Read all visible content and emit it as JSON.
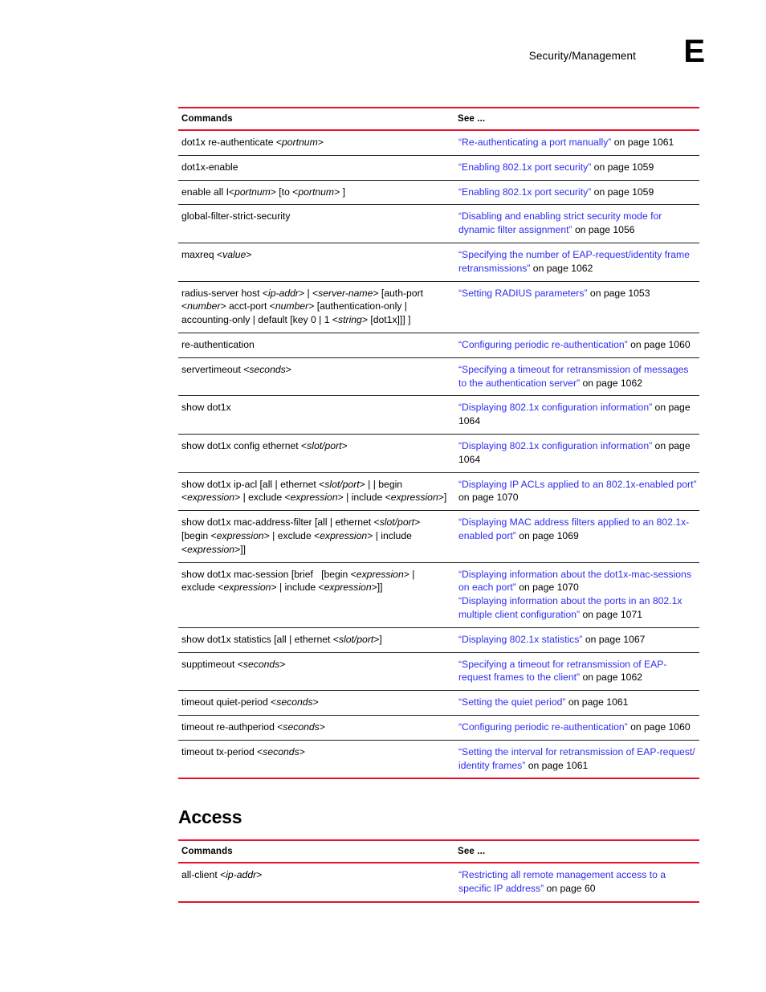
{
  "header": {
    "title": "Security/Management",
    "appendix_letter": "E"
  },
  "theme": {
    "rule_color": "#E8112D",
    "link_color": "#2d2df0",
    "text_color": "#000000",
    "row_rule_color": "#1a1a1a"
  },
  "tables": [
    {
      "id": "security-management-commands",
      "columns": [
        "Commands",
        "See ..."
      ],
      "rows": [
        {
          "command_html": "dot1x re-authenticate &lt;<em>portnum</em>&gt;",
          "see": [
            {
              "link": "“Re-authenticating a port manually”",
              "page": " on page 1061"
            }
          ]
        },
        {
          "command_html": "dot1x-enable",
          "see": [
            {
              "link": "“Enabling 802.1x port security”",
              "page": " on page 1059"
            }
          ]
        },
        {
          "command_html": "enable all I&lt;<em>portnum</em>&gt; [to &lt;<em>portnum</em>&gt; ]",
          "see": [
            {
              "link": "“Enabling 802.1x port security”",
              "page": " on page 1059"
            }
          ]
        },
        {
          "command_html": "global-filter-strict-security",
          "see": [
            {
              "link": "“Disabling and enabling strict security mode for dynamic filter assignment”",
              "page": " on page 1056"
            }
          ]
        },
        {
          "command_html": "maxreq &lt;<em>value</em>&gt;",
          "see": [
            {
              "link": "“Specifying the number of EAP-request/identity frame retransmissions”",
              "page": " on page 1062"
            }
          ]
        },
        {
          "command_html": "radius-server host &lt;<em>ip-addr</em>&gt; | &lt;<em>server-name</em>&gt; [auth-port &lt;<em>number</em>&gt; acct-port &lt;<em>number</em>&gt; [authentication-only | accounting-only | default [key 0 | 1 &lt;<em>string</em>&gt; [dot1x]]] ]",
          "see": [
            {
              "link": "“Setting RADIUS parameters”",
              "page": " on page 1053"
            }
          ]
        },
        {
          "command_html": "re-authentication",
          "see": [
            {
              "link": "“Configuring periodic re-authentication”",
              "page": " on page 1060"
            }
          ]
        },
        {
          "command_html": "servertimeout &lt;<em>seconds</em>&gt;",
          "see": [
            {
              "link": "“Specifying a timeout for retransmission of messages to the authentication server”",
              "page": " on page 1062"
            }
          ]
        },
        {
          "command_html": "show dot1x",
          "see": [
            {
              "link": "“Displaying 802.1x configuration information”",
              "page": " on page 1064"
            }
          ]
        },
        {
          "command_html": "show dot1x config ethernet &lt;<em>slot/port</em>&gt;",
          "see": [
            {
              "link": "“Displaying 802.1x configuration information”",
              "page": " on page 1064"
            }
          ]
        },
        {
          "command_html": "show dot1x ip-acl [all | ethernet &lt;<em>slot/port</em>&gt; | | begin &lt;<em>expression</em>&gt; | exclude &lt;<em>expression</em>&gt; | include &lt;<em>expression</em>&gt;]",
          "see": [
            {
              "link": "“Displaying IP ACLs applied to an 802.1x-enabled port”",
              "page": " on page 1070"
            }
          ]
        },
        {
          "command_html": "show dot1x mac-address-filter [all | ethernet &lt;<em>slot/port</em>&gt; [begin &lt;<em>expression</em>&gt; | exclude &lt;<em>expression</em>&gt; | include &lt;<em>expression</em>&gt;]]",
          "see": [
            {
              "link": "“Displaying MAC address filters applied to an 802.1x-enabled port”",
              "page": " on page 1069"
            }
          ]
        },
        {
          "command_html": "show dot1x mac-session [brief&nbsp;&nbsp; [begin &lt;<em>expression</em>&gt; | exclude &lt;<em>expression</em>&gt; | include &lt;<em>expression</em>&gt;]]",
          "see": [
            {
              "link": "“Displaying information about the dot1x-mac-sessions on each port”",
              "page": " on page 1070"
            },
            {
              "link": "“Displaying information about the ports in an 802.1x multiple client configuration”",
              "page": " on page 1071"
            }
          ]
        },
        {
          "command_html": "show dot1x statistics [all | ethernet &lt;<em>slot/port</em>&gt;]",
          "see": [
            {
              "link": "“Displaying 802.1x statistics”",
              "page": " on page 1067"
            }
          ]
        },
        {
          "command_html": "supptimeout &lt;<em>seconds</em>&gt;",
          "see": [
            {
              "link": "“Specifying a timeout for retransmission of EAP-request frames to the client”",
              "page": " on page 1062"
            }
          ]
        },
        {
          "command_html": "timeout quiet-period &lt;<em>seconds</em>&gt;",
          "see": [
            {
              "link": "“Setting the quiet period”",
              "page": " on page 1061"
            }
          ]
        },
        {
          "command_html": "timeout re-authperiod &lt;<em>seconds</em>&gt;",
          "see": [
            {
              "link": "“Configuring periodic re-authentication”",
              "page": " on page 1060"
            }
          ]
        },
        {
          "command_html": "timeout tx-period &lt;<em>seconds</em>&gt;",
          "see": [
            {
              "link": "“Setting the interval for retransmission of EAP-request/ identity frames”",
              "page": " on page 1061"
            }
          ]
        }
      ]
    },
    {
      "id": "access-commands",
      "heading": "Access",
      "columns": [
        "Commands",
        "See ..."
      ],
      "rows": [
        {
          "command_html": "all-client &lt;<em>ip-addr</em>&gt;",
          "see": [
            {
              "link": "“Restricting all remote management access to a specific IP address”",
              "page": " on page 60"
            }
          ]
        }
      ]
    }
  ]
}
